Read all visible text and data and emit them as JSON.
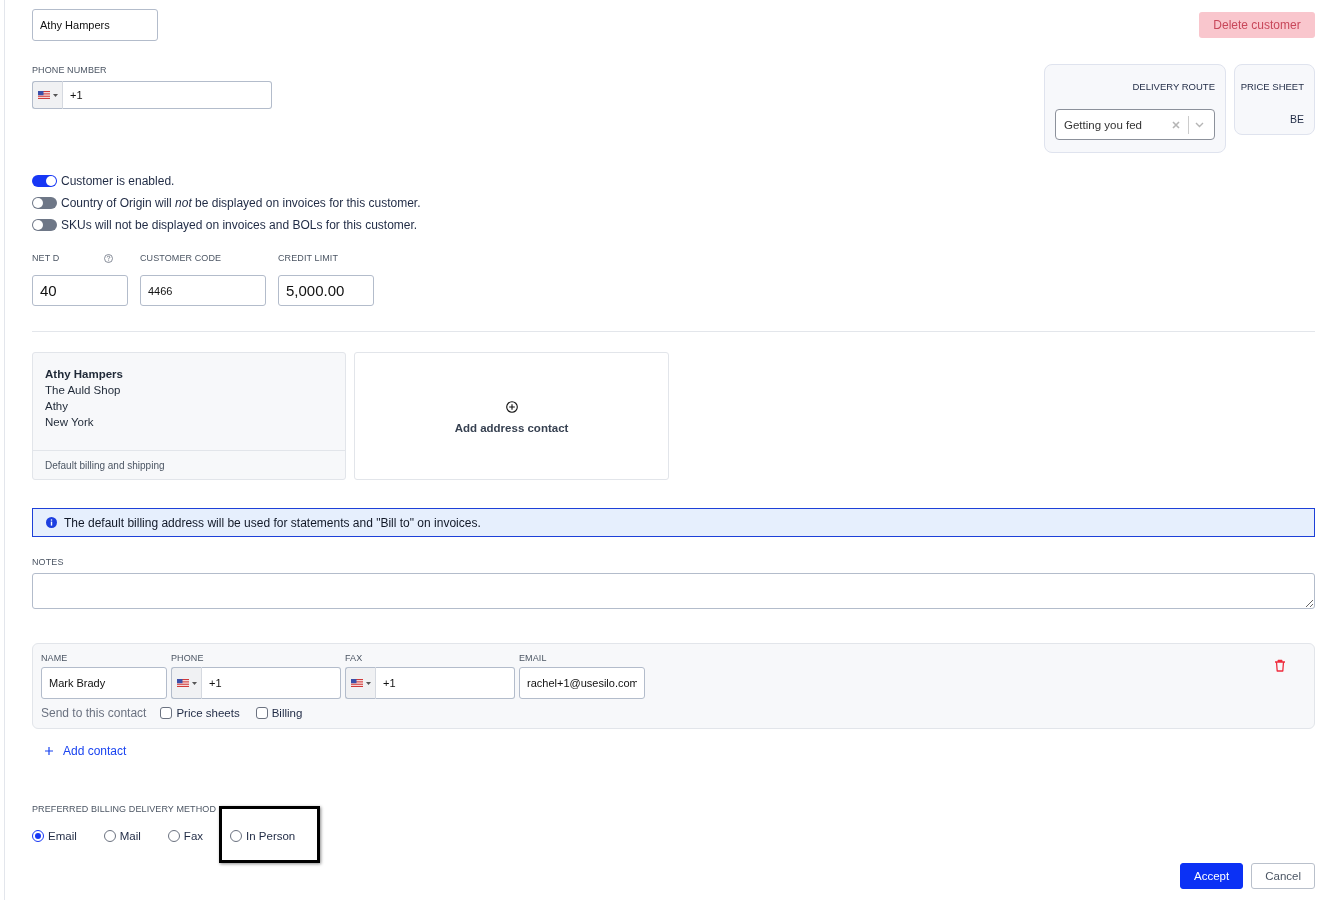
{
  "customer_name": {
    "value": "Athy Hampers"
  },
  "delete_button": {
    "label": "Delete customer",
    "disabled": true
  },
  "phone": {
    "label": "PHONE NUMBER",
    "value": "+1"
  },
  "delivery_route": {
    "label": "DELIVERY ROUTE",
    "value": "Getting you fed"
  },
  "price_sheet": {
    "label": "PRICE SHEET",
    "value": "BE"
  },
  "toggles": [
    {
      "text": "Customer is enabled.",
      "on": true
    },
    {
      "text": "Country of Origin will *not* be displayed on invoices for this customer.",
      "on": false
    },
    {
      "text": "SKUs will not be displayed on invoices and BOLs for this customer.",
      "on": false
    }
  ],
  "fields": [
    {
      "label": "NET D",
      "value": "40",
      "kind": "numeric",
      "help": true
    },
    {
      "label": "CUSTOMER CODE",
      "value": "4466",
      "kind": "text",
      "help": false
    },
    {
      "label": "CREDIT LIMIT",
      "value": "5,000.00",
      "kind": "numeric",
      "help": false
    }
  ],
  "addresses": [
    {
      "name": "Athy Hampers",
      "lines": [
        "The Auld Shop",
        "Athy",
        "New York"
      ],
      "footer": "Default billing and shipping"
    }
  ],
  "add_address": {
    "label": "Add address contact"
  },
  "info_banner": {
    "text": "The default billing address will be used for statements and \"Bill to\" on invoices."
  },
  "notes": {
    "label": "NOTES"
  },
  "contacts": [
    {
      "name_label": "NAME",
      "name": "Mark Brady",
      "phone_label": "PHONE",
      "phone": "+1",
      "fax_label": "FAX",
      "fax": "+1",
      "email_label": "EMAIL",
      "email": "rachel+1@usesilo.com",
      "send_label": "Send to this contact",
      "options": [
        {
          "label": "Price sheets",
          "checked": false
        },
        {
          "label": "Billing",
          "checked": false
        }
      ]
    }
  ],
  "add_contact": {
    "label": "Add contact"
  },
  "billing_method": {
    "label": "PREFERRED BILLING DELIVERY METHOD",
    "options": [
      {
        "label": "Email",
        "selected": true,
        "highlighted": false
      },
      {
        "label": "Mail",
        "selected": false,
        "highlighted": false
      },
      {
        "label": "Fax",
        "selected": false,
        "highlighted": false
      },
      {
        "label": "In Person",
        "selected": false,
        "highlighted": true
      }
    ]
  },
  "actions": [
    {
      "label": "Accept",
      "kind": "primary"
    },
    {
      "label": "Cancel",
      "kind": "secondary"
    }
  ]
}
